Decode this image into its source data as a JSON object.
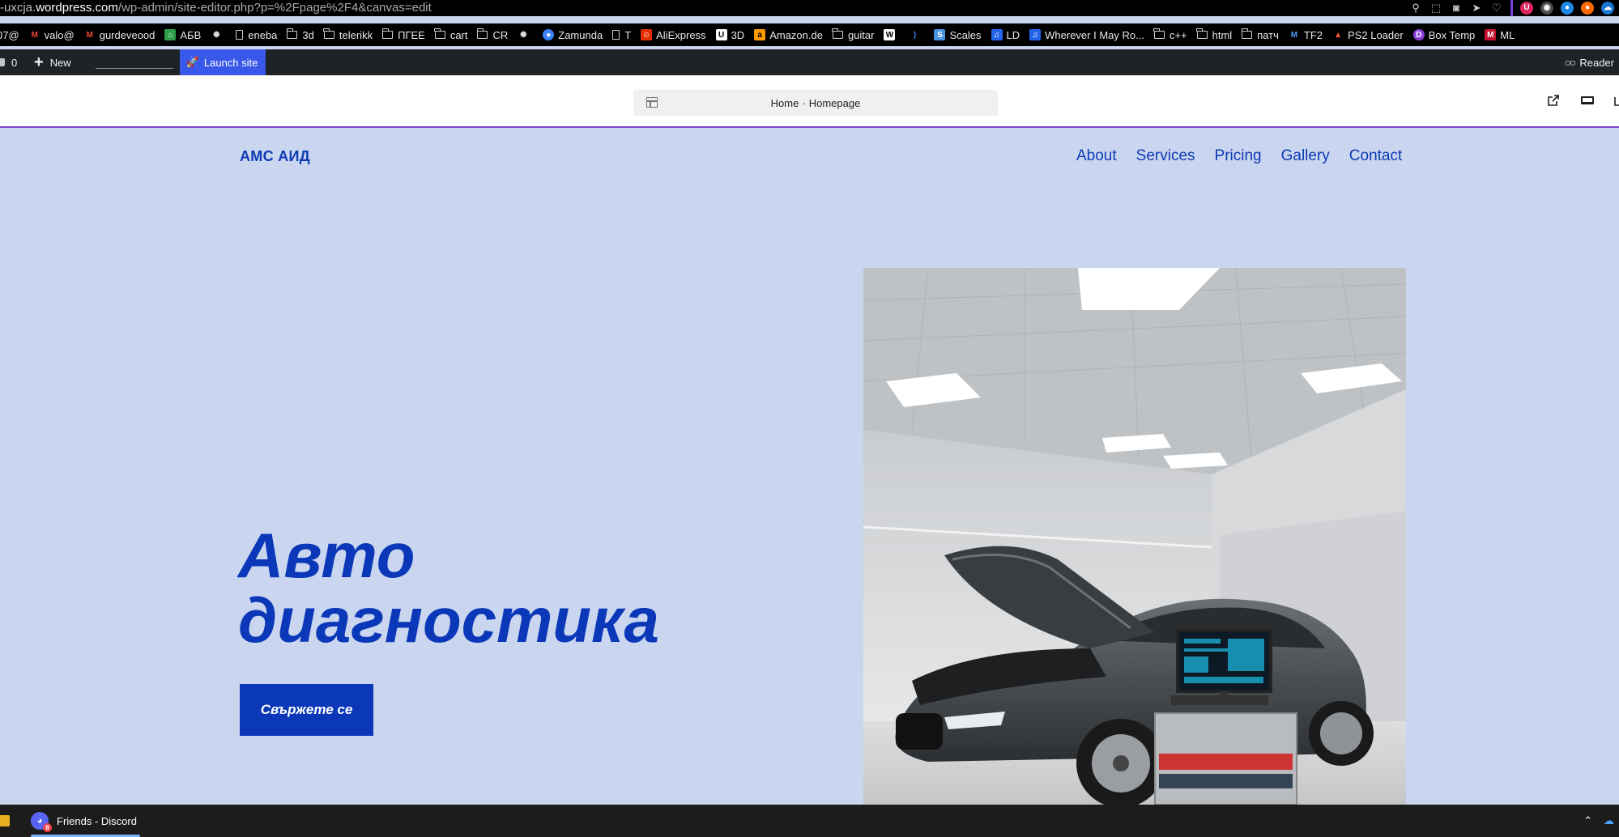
{
  "browser": {
    "url_prefix": "-uxcja.",
    "url_host": "wordpress.com",
    "url_path": "/wp-admin/site-editor.php?p=%2Fpage%2F4&canvas=edit"
  },
  "bookmarks": [
    {
      "label": "07@",
      "type": "text"
    },
    {
      "label": "valo@",
      "type": "gmail"
    },
    {
      "label": "gurdeveood",
      "type": "gmail"
    },
    {
      "label": "АБВ",
      "type": "abv"
    },
    {
      "label": "",
      "type": "openai"
    },
    {
      "label": "eneba",
      "type": "page"
    },
    {
      "label": "3d",
      "type": "folder"
    },
    {
      "label": "telerikk",
      "type": "folder"
    },
    {
      "label": "ПГЕЕ",
      "type": "folder"
    },
    {
      "label": "cart",
      "type": "folder"
    },
    {
      "label": "CR",
      "type": "folder"
    },
    {
      "label": "",
      "type": "openai"
    },
    {
      "label": "Zamunda",
      "type": "globe"
    },
    {
      "label": "T",
      "type": "page"
    },
    {
      "label": "AliExpress",
      "type": "ali"
    },
    {
      "label": "3D",
      "type": "u"
    },
    {
      "label": "Amazon.de",
      "type": "amazon"
    },
    {
      "label": "guitar",
      "type": "folder"
    },
    {
      "label": "",
      "type": "w"
    },
    {
      "label": "",
      "type": "moon"
    },
    {
      "label": "Scales",
      "type": "scales"
    },
    {
      "label": "LD",
      "type": "ld"
    },
    {
      "label": "Wherever I May Ro...",
      "type": "ld"
    },
    {
      "label": "c++",
      "type": "folder"
    },
    {
      "label": "html",
      "type": "folder"
    },
    {
      "label": "патч",
      "type": "folder"
    },
    {
      "label": "TF2",
      "type": "m"
    },
    {
      "label": "PS2 Loader",
      "type": "ps"
    },
    {
      "label": "Box Temp",
      "type": "boxtemp"
    },
    {
      "label": "ML",
      "type": "ml"
    }
  ],
  "wp_admin": {
    "comments_count": "0",
    "new_label": "New",
    "launch_label": "Launch site",
    "reader_label": "Reader"
  },
  "editor": {
    "document_title": "Home",
    "document_subtitle": "Homepage",
    "separator": "·"
  },
  "site": {
    "title": "АМС АИД",
    "nav": [
      "About",
      "Services",
      "Pricing",
      "Gallery",
      "Contact"
    ],
    "hero_line1": "Авто",
    "hero_line2": "диагностика",
    "cta_label": "Свържете се"
  },
  "taskbar": {
    "app_label": "Friends - Discord",
    "badge": "8"
  },
  "colors": {
    "page_bg": "#cad6ef",
    "brand_blue": "#0a38b8",
    "launch_blue": "#3858e9",
    "wp_bar": "#1d2327"
  }
}
